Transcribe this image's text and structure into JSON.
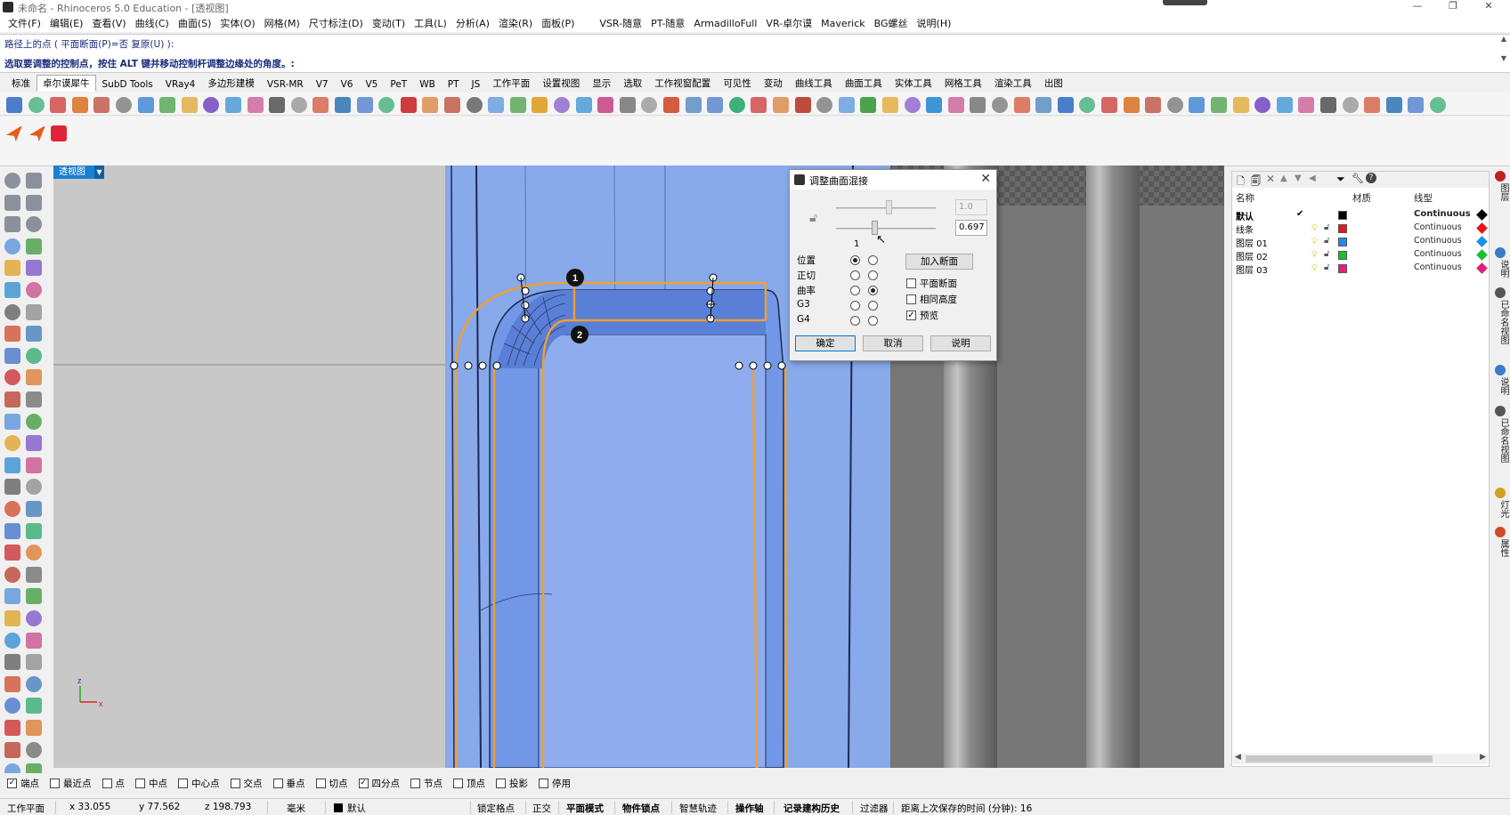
{
  "window": {
    "title": "未命名 - Rhinoceros 5.0 Education - [透视图]",
    "minimize": "—",
    "restore": "❐",
    "close": "✕"
  },
  "menu": [
    "文件(F)",
    "编辑(E)",
    "查看(V)",
    "曲线(C)",
    "曲面(S)",
    "实体(O)",
    "网格(M)",
    "尺寸标注(D)",
    "变动(T)",
    "工具(L)",
    "分析(A)",
    "渲染(R)",
    "面板(P)",
    "VSR-随意",
    "PT-随意",
    "ArmadilloFull",
    "VR-卓尔谟",
    "Maverick",
    "BG螺丝",
    "说明(H)"
  ],
  "command": {
    "line1": "路径上的点 ( 平面断面(P)=否  复原(U) ):",
    "line2": "选取要调整的控制点，按住 ALT 键并移动控制杆调整边缘处的角度。:"
  },
  "tabs": [
    "标准",
    "卓尔谟犀牛",
    "SubD Tools",
    "VRay4",
    "多边形建模",
    "VSR-MR",
    "V7",
    "V6",
    "V5",
    "PeT",
    "WB",
    "PT",
    "JS",
    "工作平面",
    "设置视图",
    "显示",
    "选取",
    "工作视窗配置",
    "可见性",
    "变动",
    "曲线工具",
    "曲面工具",
    "实体工具",
    "网格工具",
    "渲染工具",
    "出图"
  ],
  "active_tab": "卓尔谟犀牛",
  "viewport": {
    "label": "透视图",
    "markers": [
      "1",
      "2"
    ],
    "axes": {
      "z": "z",
      "x": "x",
      "y": "y"
    }
  },
  "dialog": {
    "title": "调整曲面混接",
    "slider1_value": "1.0",
    "slider2_value": "0.697",
    "slider_tick": "1",
    "rows": [
      {
        "label": "位置",
        "left": true,
        "right": false
      },
      {
        "label": "正切",
        "left": false,
        "right": false
      },
      {
        "label": "曲率",
        "left": false,
        "right": true
      },
      {
        "label": "G3",
        "left": false,
        "right": false
      },
      {
        "label": "G4",
        "left": false,
        "right": false
      }
    ],
    "add_section": "加入断面",
    "checks": [
      {
        "label": "平面断面",
        "checked": false
      },
      {
        "label": "相同高度",
        "checked": false
      },
      {
        "label": "预览",
        "checked": true
      }
    ],
    "ok": "确定",
    "cancel": "取消",
    "help": "说明"
  },
  "layers": {
    "headers": {
      "name": "名称",
      "material": "材质",
      "linetype": "线型"
    },
    "rows": [
      {
        "name": "默认",
        "current": "✔",
        "color": "#000000",
        "linetype": "Continuous",
        "bold": true
      },
      {
        "name": "线条",
        "current": "",
        "color": "#e8141e",
        "linetype": "Continuous",
        "bold": false
      },
      {
        "name": "图层 01",
        "current": "",
        "color": "#1d8fe8",
        "linetype": "Continuous",
        "bold": false
      },
      {
        "name": "图层 02",
        "current": "",
        "color": "#19c22f",
        "linetype": "Continuous",
        "bold": false
      },
      {
        "name": "图层 03",
        "current": "",
        "color": "#e0217a",
        "linetype": "Continuous",
        "bold": false
      }
    ]
  },
  "right_tabs": [
    "图层",
    "说明",
    "已命名视图",
    "说明",
    "已命名视图",
    "灯光",
    "属性"
  ],
  "osnap": [
    {
      "label": "端点",
      "checked": true
    },
    {
      "label": "最近点",
      "checked": false
    },
    {
      "label": "点",
      "checked": false
    },
    {
      "label": "中点",
      "checked": false
    },
    {
      "label": "中心点",
      "checked": false
    },
    {
      "label": "交点",
      "checked": false
    },
    {
      "label": "垂点",
      "checked": false
    },
    {
      "label": "切点",
      "checked": false
    },
    {
      "label": "四分点",
      "checked": true
    },
    {
      "label": "节点",
      "checked": false
    },
    {
      "label": "顶点",
      "checked": false
    },
    {
      "label": "投影",
      "checked": false
    },
    {
      "label": "停用",
      "checked": false
    }
  ],
  "status": {
    "cplane": "工作平面",
    "x": "x 33.055",
    "y": "y 77.562",
    "z": "z 198.793",
    "units": "毫米",
    "layer": "默认",
    "grid_snap": "锁定格点",
    "ortho": "正交",
    "planar": "平面模式",
    "osnap": "物件锁点",
    "smarttrack": "智慧轨迹",
    "gumball": "操作轴",
    "history": "记录建构历史",
    "filter": "过滤器",
    "autosave": "距离上次保存的时间 (分钟): 16"
  },
  "colors": {
    "viewport_bg": "#c9c9c9",
    "surface_blue": "#7fa6ea",
    "edge_orange": "#f0a030",
    "accent_blue": "#1a7fd1"
  }
}
